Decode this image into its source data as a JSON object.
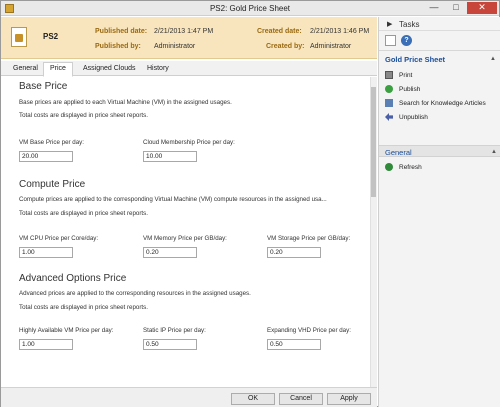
{
  "window": {
    "title": "PS2: Gold Price Sheet",
    "minimize": "—",
    "maximize": "□",
    "close": "✕"
  },
  "header": {
    "name": "PS2",
    "published_date_label": "Published date:",
    "published_date_value": "2/21/2013 1:47 PM",
    "published_by_label": "Published by:",
    "published_by_value": "Administrator",
    "created_date_label": "Created date:",
    "created_date_value": "2/21/2013 1:46 PM",
    "created_by_label": "Created by:",
    "created_by_value": "Administrator"
  },
  "tabs": [
    "General",
    "Price",
    "Assigned Clouds",
    "History"
  ],
  "active_tab": "Price",
  "base": {
    "title": "Base Price",
    "desc1": "Base prices are applied to each Virtual Machine (VM) in the assigned usages.",
    "desc2": "Total costs are displayed in price sheet reports.",
    "vm_label": "VM Base Price per day:",
    "vm_value": "20.00",
    "cloud_label": "Cloud Membership Price per day:",
    "cloud_value": "10.00"
  },
  "compute": {
    "title": "Compute Price",
    "desc1": "Compute prices are applied to the corresponding Virtual Machine (VM) compute resources in the assigned usa...",
    "desc2": "Total costs are displayed in price sheet reports.",
    "cpu_label": "VM CPU Price per Core/day:",
    "cpu_value": "1.00",
    "mem_label": "VM Memory Price per GB/day:",
    "mem_value": "0.20",
    "storage_label": "VM Storage Price per GB/day:",
    "storage_value": "0.20"
  },
  "advanced": {
    "title": "Advanced Options Price",
    "desc1": "Advanced prices are applied to the corresponding resources in the assigned usages.",
    "desc2": "Total costs are displayed in price sheet reports.",
    "ha_label": "Highly Available VM Price per day:",
    "ha_value": "1.00",
    "ip_label": "Static IP Price per day:",
    "ip_value": "0.50",
    "vhd_label": "Expanding VHD Price per day:",
    "vhd_value": "0.50"
  },
  "footer": {
    "ok": "OK",
    "cancel": "Cancel",
    "apply": "Apply"
  },
  "tasks": {
    "title": "Tasks",
    "section_title": "Gold Price Sheet",
    "items": [
      "Print",
      "Publish",
      "Search for Knowledge Articles",
      "Unpublish"
    ],
    "general_title": "General",
    "general_items": [
      "Refresh"
    ]
  },
  "colors": {
    "header_band": "#f8e5bd",
    "accent_label": "#9a6a12",
    "link_blue": "#1b4e9a",
    "close_red": "#c7453a"
  }
}
